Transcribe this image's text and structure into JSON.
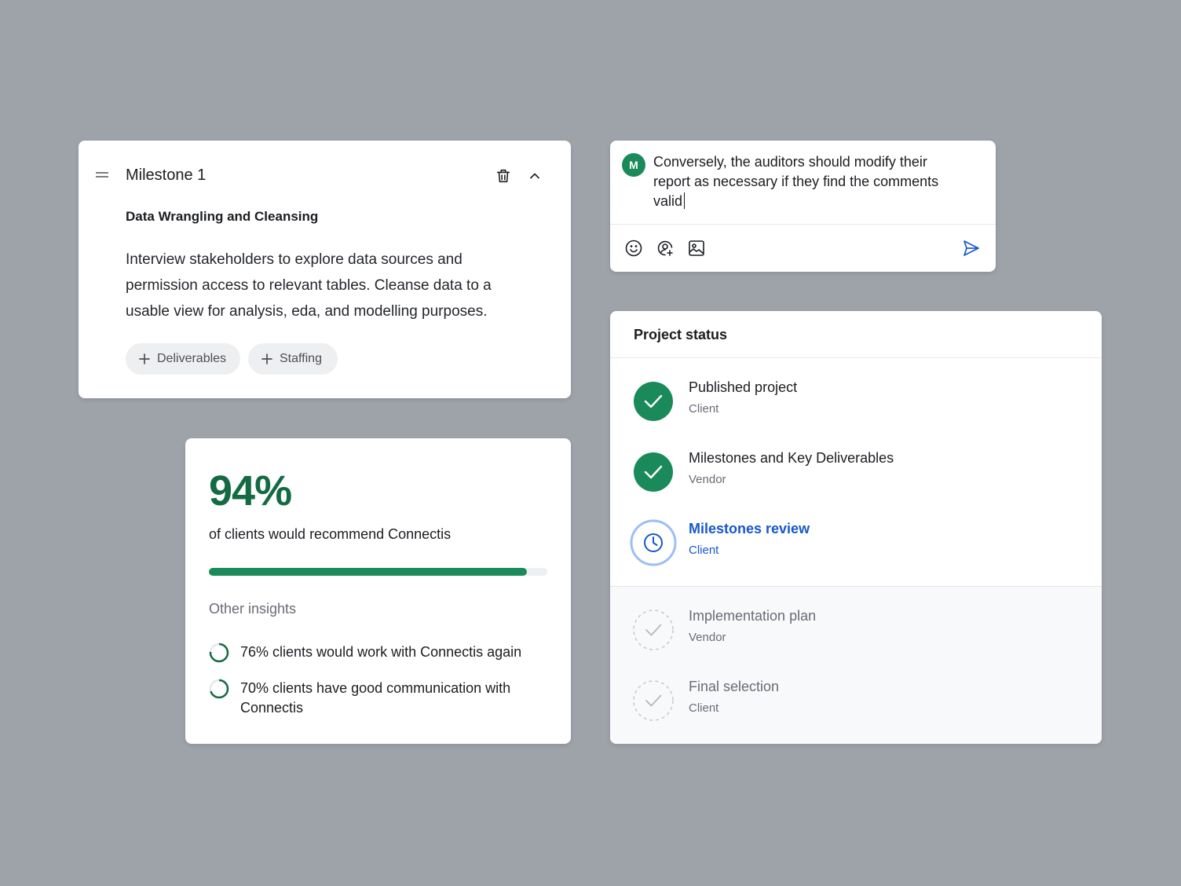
{
  "colors": {
    "background": "#9ea2a9",
    "accent_green": "#1a8a5a",
    "dark_green": "#146b43",
    "accent_blue": "#1758c9"
  },
  "milestone": {
    "title": "Milestone 1",
    "subtitle": "Data Wrangling and Cleansing",
    "description": "Interview stakeholders to explore data sources and permission access to relevant tables. Cleanse data to a usable view for analysis, eda, and modelling purposes.",
    "chips": [
      "Deliverables",
      "Staffing"
    ],
    "icons": [
      "drag-handle-icon",
      "trash-icon",
      "chevron-up-icon",
      "plus-icon"
    ]
  },
  "comment": {
    "avatar_initial": "M",
    "text": "Conversely, the auditors should modify their report as necessary if they find the comments valid",
    "icons": [
      "emoji-icon",
      "mention-icon",
      "image-icon",
      "send-icon"
    ]
  },
  "stats": {
    "headline": "94%",
    "headline_label": "of clients would recommend Connectis",
    "progress": 0.94,
    "other_title": "Other insights",
    "insights": [
      {
        "text": "76% clients would work with Connectis again",
        "value": 0.76
      },
      {
        "text": "70% clients have good communication with Connectis",
        "value": 0.7
      }
    ]
  },
  "status": {
    "title": "Project status",
    "steps": [
      {
        "label": "Published project",
        "role": "Client",
        "state": "done"
      },
      {
        "label": "Milestones and Key Deliverables",
        "role": "Vendor",
        "state": "done"
      },
      {
        "label": "Milestones review",
        "role": "Client",
        "state": "active"
      },
      {
        "label": "Implementation plan",
        "role": "Vendor",
        "state": "pending"
      },
      {
        "label": "Final selection",
        "role": "Client",
        "state": "pending"
      }
    ]
  }
}
